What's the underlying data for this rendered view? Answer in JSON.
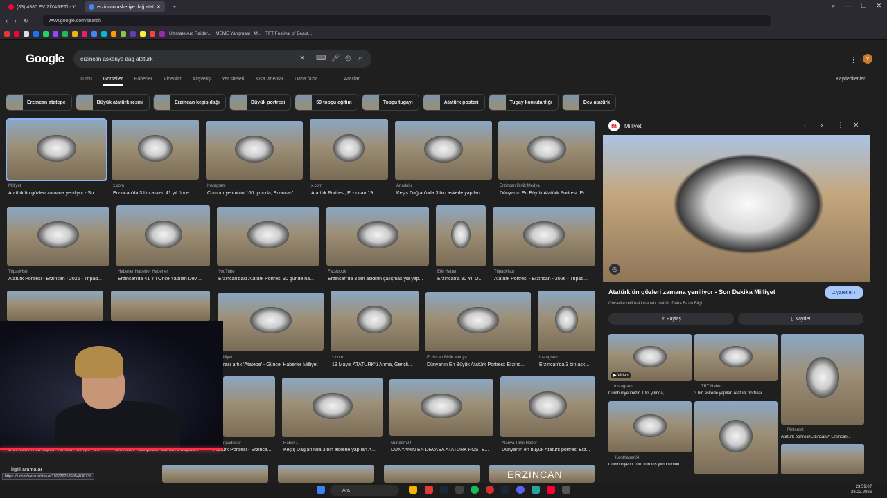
{
  "browser": {
    "tabs": [
      {
        "label": "(83) 4380 EV ZİYARETİ - Yi",
        "color": "#ff0033",
        "active": false
      },
      {
        "label": "erzincan askeriye dağ atat",
        "color": "#4285f4",
        "active": true
      }
    ],
    "url": "www.google.com/search",
    "bookmarks": [
      "Ultimate Arc Raider...",
      "MEME Yarışması | M...",
      "TFT Festival of Beast..."
    ]
  },
  "google": {
    "logo": "Google",
    "query": "erzincan askeriye dağ atatürk",
    "tabs": [
      "Tümü",
      "Görseller",
      "Haberler",
      "Videolar",
      "Alışveriş",
      "Yer siteleri",
      "Kısa videolar",
      "Daha fazla"
    ],
    "tools": "Araçlar",
    "saved": "Kaydedilenler",
    "avatar_letter": "Y"
  },
  "chips": [
    "Erzincan atatepe",
    "Büyük atatürk resmi",
    "Erzincan keşiş dağı",
    "Büyük portresi",
    "59 topçu eğitim",
    "Topçu tugayı",
    "Atatürk posteri",
    "Tugay komutanlığı",
    "Dev atatürk"
  ],
  "results": [
    {
      "src": "Milliyet",
      "cap": "Atatürk'ün gözleri zamana yeniliyor - So..."
    },
    {
      "src": "x.com",
      "cap": "Erzincan'da 3 bin asker, 41 yıl önce..."
    },
    {
      "src": "Instagram",
      "cap": "Cumhuriyetimizin 100. yılında, Erzincan'..."
    },
    {
      "src": "x.com",
      "cap": "Atatürk Portresi, Erzincan 19..."
    },
    {
      "src": "Anadolu",
      "cap": "Keşiş Dağları'nda 3 bin askerle yapılan ..."
    },
    {
      "src": "Erzincan Birlik Medya",
      "cap": "Dünyanın En Büyük Atatürk Portresi: Er..."
    },
    {
      "src": "Tripadvisor",
      "cap": "Atatürk Portresi - Erzincan - 2026 - Tripad..."
    },
    {
      "src": "Haberler Haberler Haberler",
      "cap": "Erzincan'da 41 Yıl Önce Yapılan Dev ..."
    },
    {
      "src": "YouTube",
      "cap": "Erzincan'daki Atatürk Portresi 30 günde na..."
    },
    {
      "src": "Facebook",
      "cap": "Erzincan'da 3 bin askerin çalışmasıyla yap..."
    },
    {
      "src": "Elkl Haber",
      "cap": "Erzincan'a 30 Yıl Ö..."
    },
    {
      "src": "Tripadvisor",
      "cap": "Atatürk Portresi - Erzincan - 2026 - Tripad..."
    },
    {
      "src": "Milliyet",
      "cap": "rası artık 'Atatepe' - Güncel Haberler Milliyet"
    },
    {
      "src": "x.com",
      "cap": "19 Mayıs ATATÜRK'ü Anma, Gençli..."
    },
    {
      "src": "Erzincan Birlik Medya",
      "cap": "Dünyanın En Büyük Atatürk Portresi: Erzinc..."
    },
    {
      "src": "Instagram",
      "cap": "Erzincan'da 3 bin ask..."
    },
    {
      "src": "Erzincan'ın Ala Tepesi yeniden ışıl ışıl - E...",
      "cap": ""
    },
    {
      "src": "Erzincan Valiliğinden solmaya başlad...",
      "cap": ""
    },
    {
      "src": "ripadvisor",
      "cap": "Atatürk Portresi - Erzinca..."
    },
    {
      "src": "Haber 1",
      "cap": "Keşiş Dağları'nda 3 bin askerle yapılan A..."
    },
    {
      "src": "Gündem24",
      "cap": "DÜNYANIN EN DEVASA ATATÜRK POSTE..."
    },
    {
      "src": "Alanya Time Haber",
      "cap": "Dünyanın en büyük Atatürk portresi Erz..."
    }
  ],
  "panel": {
    "source": "Milliyet",
    "title": "Atatürk'ün gözleri zamana yeniliyor - Son Dakika Milliyet",
    "note": "Görseller telif hakkına tabi olabilir. Daha Fazla Bilgi",
    "visit": "Ziyaret et",
    "share": "Paylaş",
    "save": "Kaydet",
    "video_badge": "Video",
    "thumbs": [
      {
        "src": "Instagram",
        "cap": "Cumhuriyetimizin 100. yılında,..."
      },
      {
        "src": "TRT Haber",
        "cap": "3 bin askerle yapılan Atatürk portresi..."
      },
      {
        "src": "Pinterest",
        "cap": "Atatürk portresi/Erzincan/// Erzincan..."
      },
      {
        "src": "Kenthaber24",
        "cap": "Cumhuriyetin 100. kuruluş yıldönümün..."
      }
    ]
  },
  "related": "İlgili aramalar",
  "overlay_text": "ERZİNCAN",
  "status_url": "https://x.com/waplus/status/1167262539954036736",
  "taskbar": {
    "search": "Ara",
    "time": "23:59:07",
    "date": "28.02.2026"
  }
}
